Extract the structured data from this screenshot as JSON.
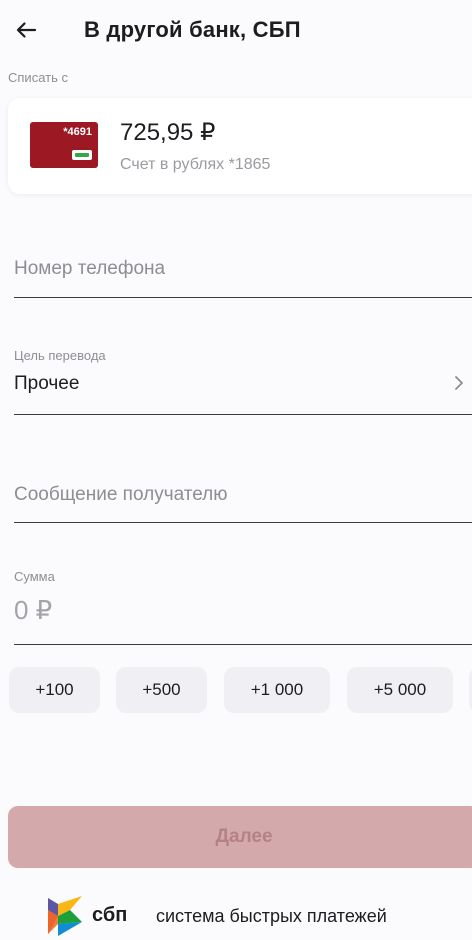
{
  "header": {
    "title": "В другой банк, СБП",
    "back_icon": "arrow-left-icon"
  },
  "debit": {
    "label": "Списать с",
    "card_number": "*4691",
    "balance": "725,95 ₽",
    "account_description": "Счет в рублях *1865",
    "card_color": "#9c1823"
  },
  "phone": {
    "placeholder": "Номер телефона"
  },
  "purpose": {
    "label": "Цель перевода",
    "value": "Прочее",
    "chevron_icon": "chevron-right-icon"
  },
  "message": {
    "placeholder": "Сообщение получателю"
  },
  "amount": {
    "label": "Сумма",
    "value": "0 ₽"
  },
  "quick_amounts": [
    "+100",
    "+500",
    "+1 000",
    "+5 000"
  ],
  "next_button": {
    "label": "Далее",
    "color": "#d4a9ab"
  },
  "footer": {
    "sbp_short": "сбп",
    "sbp_full": "система быстрых платежей",
    "logo_icon": "sbp-logo-icon"
  }
}
